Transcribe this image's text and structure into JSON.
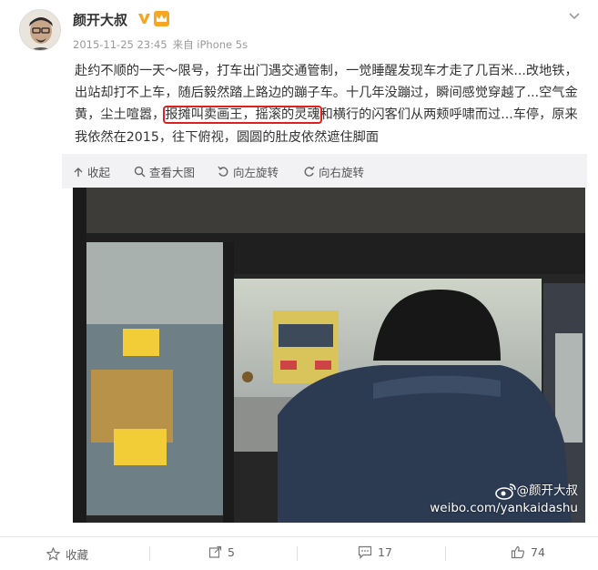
{
  "post": {
    "author": "颜开大叔",
    "timestamp": "2015-11-25 23:45",
    "source": "来自 iPhone 5s",
    "text_before": "赴约不顺的一天～限号，打车出门遇交通管制，一觉睡醒发现车才走了几百米...改地铁，出站却打不上车，随后毅然踏上路边的蹦子车。十几年没蹦过，瞬间感觉穿越了...空气金黄，尘土喧嚣，",
    "text_highlight": "报摊叫卖画王，摇滚的灵魂",
    "text_after": "和横行的闪客们从两颊呼啸而过...车停，原来我依然在2015，往下俯视，圆圆的肚皮依然遮住脚面"
  },
  "toolbar": {
    "collapse": "收起",
    "view_large": "查看大图",
    "rotate_left": "向左旋转",
    "rotate_right": "向右旋转"
  },
  "watermark": {
    "handle": "@颜开大叔",
    "url": "weibo.com/yankaidashu"
  },
  "actions": {
    "favorite": "收藏",
    "repost_count": "5",
    "comment_count": "17",
    "like_count": "74"
  },
  "colors": {
    "highlight_box": "#e0201f",
    "verified_badge": "#f5a623",
    "toolbar_bg": "#f2f2f5"
  },
  "icons": [
    "avatar",
    "verified-icon",
    "crown-icon",
    "chevron-down-icon",
    "collapse-icon",
    "search-icon",
    "rotate-left-icon",
    "rotate-right-icon",
    "weibo-logo-icon",
    "star-icon",
    "repost-icon",
    "comment-icon",
    "like-icon"
  ]
}
